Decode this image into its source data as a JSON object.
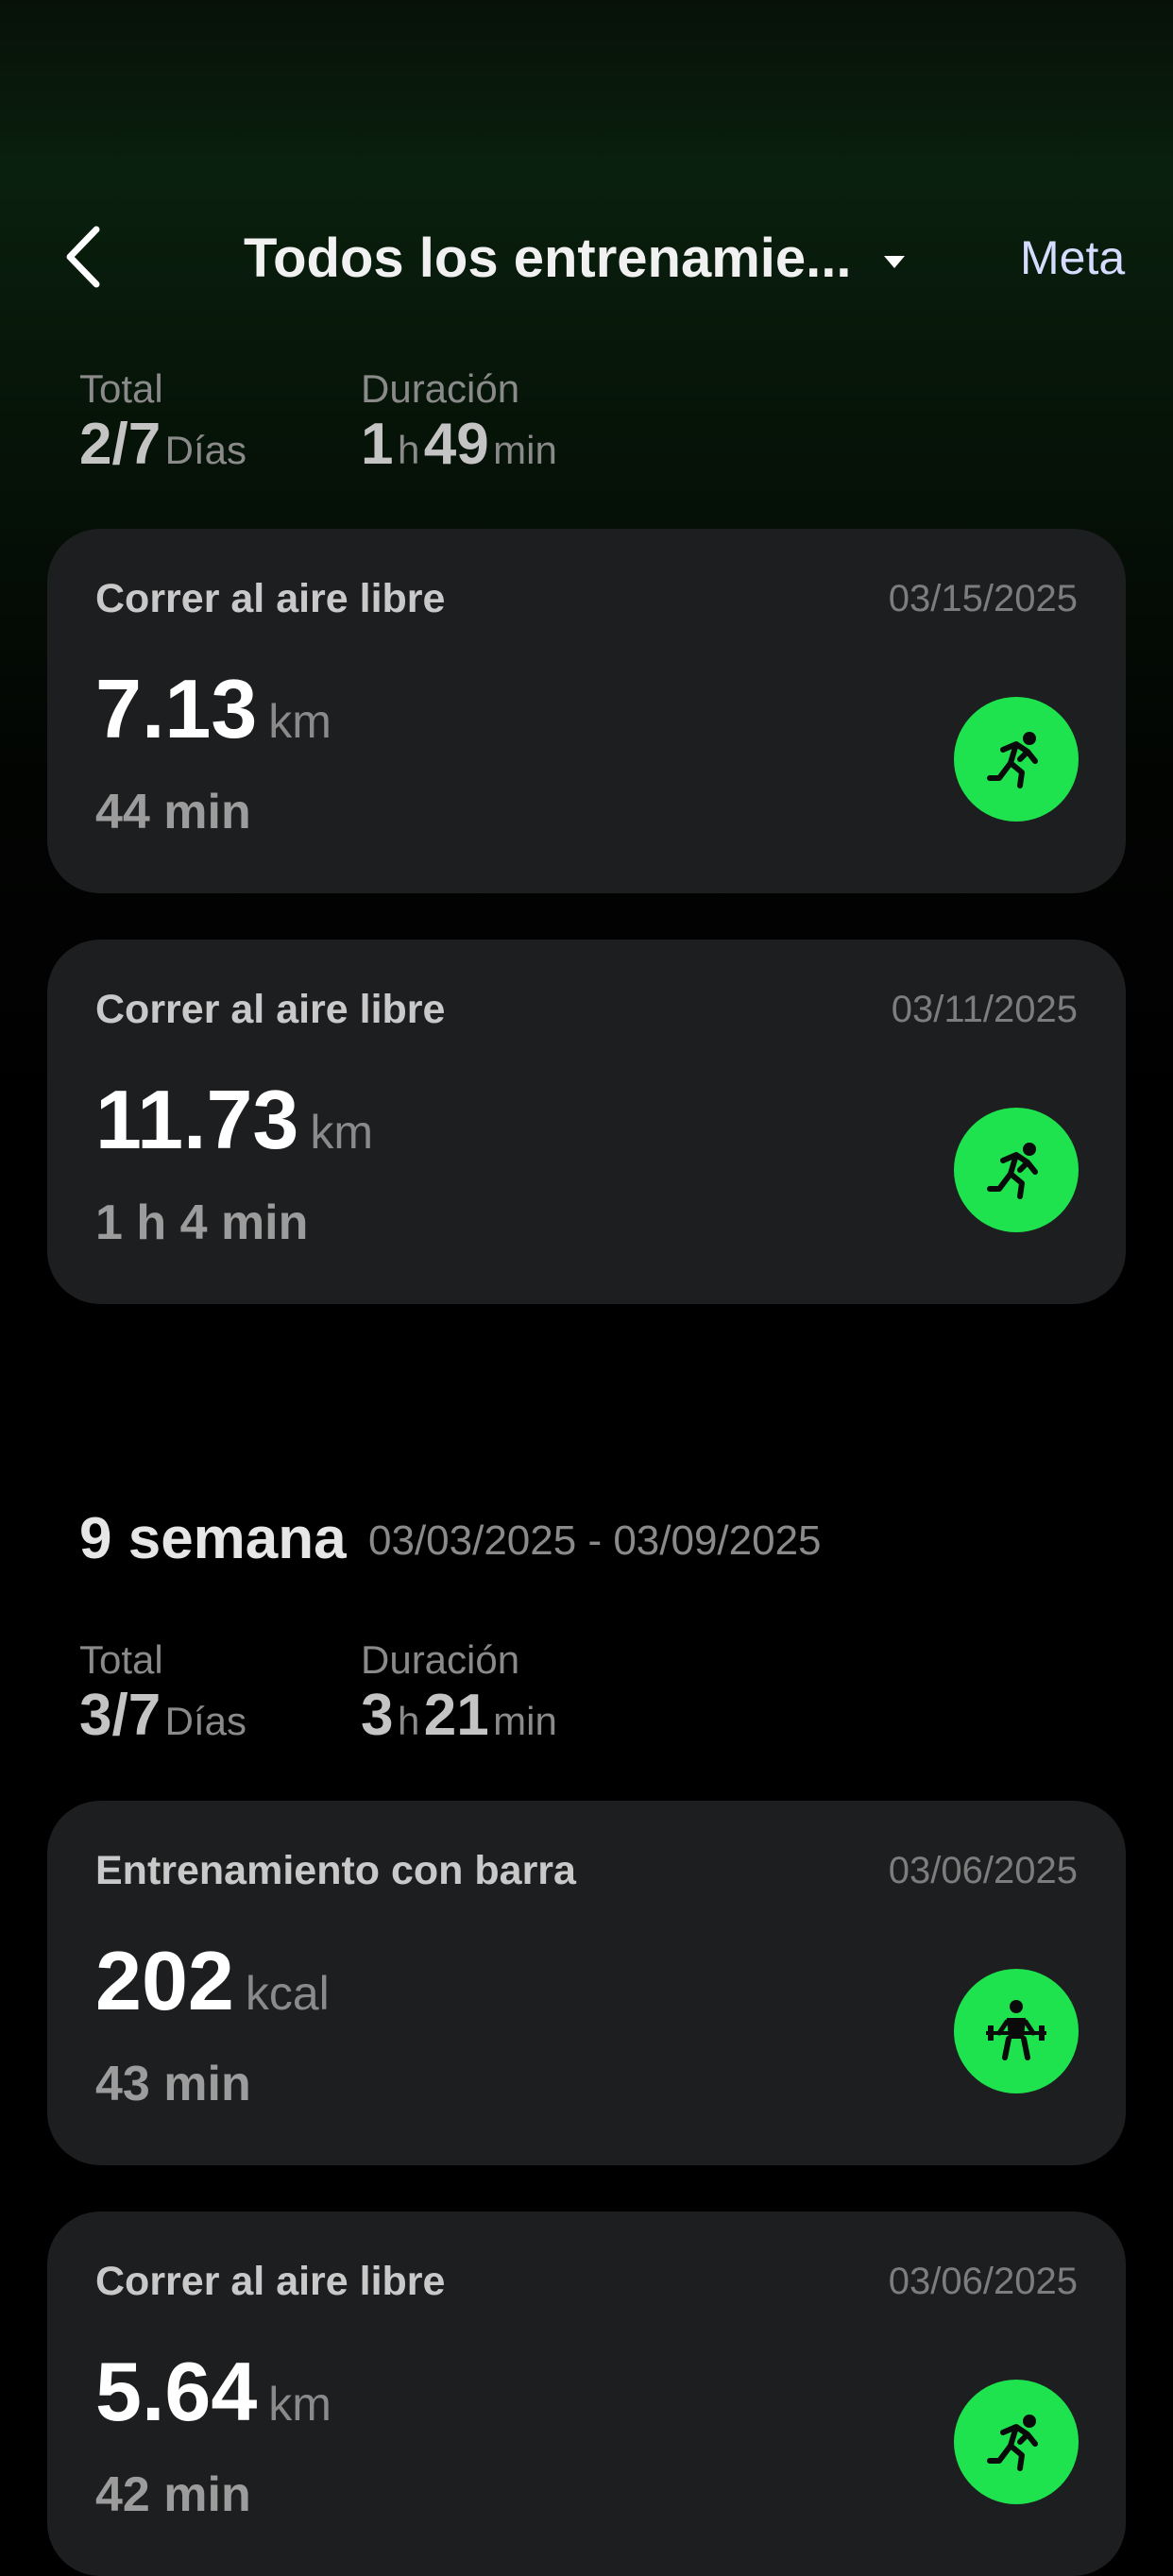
{
  "header": {
    "title": "Todos los entrenamie...",
    "goal_link": "Meta",
    "back_icon": "chevron-left-icon",
    "dropdown_icon": "caret-down-icon"
  },
  "colors": {
    "accent_green": "#1ee34f",
    "card_bg": "#1d1e20",
    "goal_link": "#d5dcff"
  },
  "week1": {
    "summary": {
      "total_label": "Total",
      "total_value": "2/7",
      "total_unit": "Días",
      "duration_label": "Duración",
      "duration_hours": "1",
      "duration_hours_unit": "h",
      "duration_minutes": "49",
      "duration_minutes_unit": "min"
    },
    "workouts": [
      {
        "title": "Correr al aire libre",
        "date": "03/15/2025",
        "value": "7.13",
        "unit": "km",
        "duration": "44 min",
        "icon": "running-icon"
      },
      {
        "title": "Correr al aire libre",
        "date": "03/11/2025",
        "value": "11.73",
        "unit": "km",
        "duration": "1  h 4 min",
        "icon": "running-icon"
      }
    ]
  },
  "week2": {
    "name": "9 semana",
    "range": "03/03/2025 - 03/09/2025",
    "summary": {
      "total_label": "Total",
      "total_value": "3/7",
      "total_unit": "Días",
      "duration_label": "Duración",
      "duration_hours": "3",
      "duration_hours_unit": "h",
      "duration_minutes": "21",
      "duration_minutes_unit": "min"
    },
    "workouts": [
      {
        "title": "Entrenamiento con barra",
        "date": "03/06/2025",
        "value": "202",
        "unit": "kcal",
        "duration": "43 min",
        "icon": "barbell-icon"
      },
      {
        "title": "Correr al aire libre",
        "date": "03/06/2025",
        "value": "5.64",
        "unit": "km",
        "duration": "42 min",
        "icon": "running-icon"
      }
    ]
  }
}
